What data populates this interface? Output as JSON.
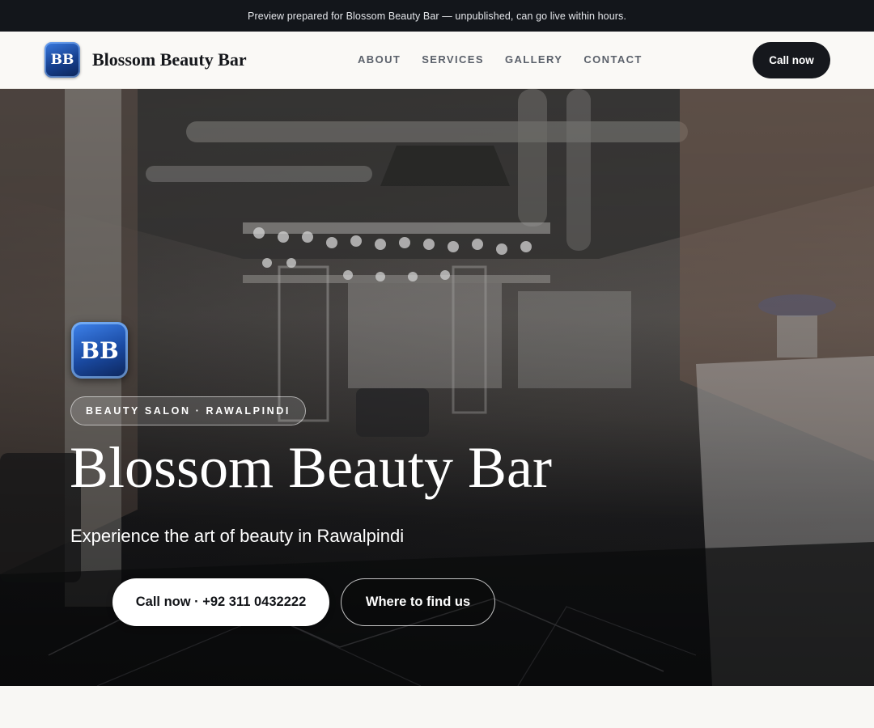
{
  "banner": {
    "text": "Preview prepared for Blossom Beauty Bar — unpublished, can go live within hours."
  },
  "header": {
    "logo_text": "BB",
    "brand_name": "Blossom Beauty Bar",
    "nav": [
      {
        "label": "ABOUT"
      },
      {
        "label": "SERVICES"
      },
      {
        "label": "GALLERY"
      },
      {
        "label": "CONTACT"
      }
    ],
    "cta_label": "Call now"
  },
  "hero": {
    "logo_text": "BB",
    "tag": "BEAUTY SALON · RAWALPINDI",
    "title": "Blossom Beauty Bar",
    "subtitle": "Experience the art of beauty in Rawalpindi",
    "primary_cta": "Call now · +92 311 0432222",
    "secondary_cta": "Where to find us",
    "background_image": "salon-interior-photo"
  },
  "colors": {
    "banner_bg": "#13161b",
    "header_bg": "#faf9f6",
    "cta_dark": "#16181d",
    "logo_blue": "#1a4aa2",
    "hero_text": "#ffffff"
  }
}
